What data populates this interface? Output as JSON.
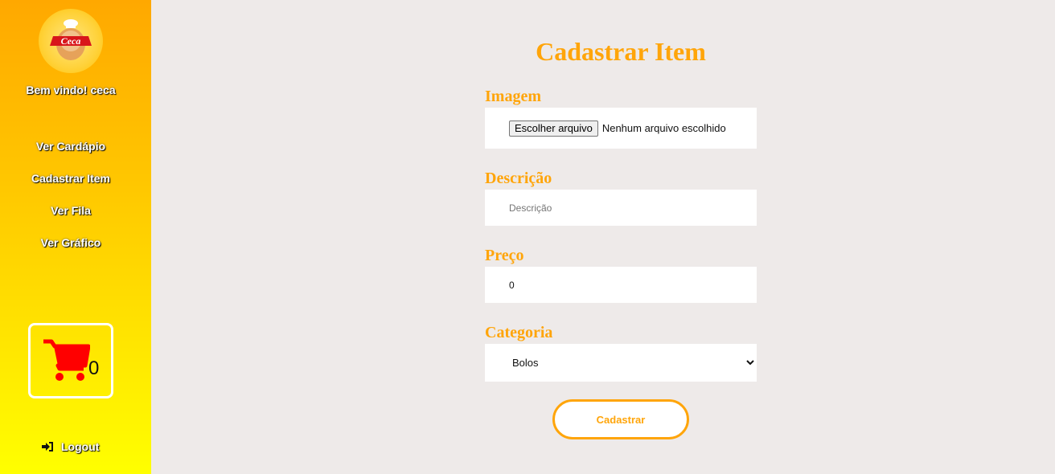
{
  "sidebar": {
    "logo_text": "Ceca",
    "welcome": "Bem vindo! ceca",
    "items": [
      {
        "label": "Ver Cardápio"
      },
      {
        "label": "Cadastrar Item"
      },
      {
        "label": "Ver Fila"
      },
      {
        "label": "Ver Gráfico"
      }
    ],
    "cart": {
      "icon": "shopping-cart-icon",
      "count": "0"
    },
    "logout": {
      "icon": "sign-in-icon",
      "label": "Logout"
    }
  },
  "form": {
    "title": "Cadastrar Item",
    "image": {
      "label": "Imagem",
      "button": "Escolher arquivo",
      "status": "Nenhum arquivo escolhido"
    },
    "description": {
      "label": "Descrição",
      "placeholder": "Descrição",
      "value": ""
    },
    "price": {
      "label": "Preço",
      "value": "0"
    },
    "category": {
      "label": "Categoria",
      "selected": "Bolos"
    },
    "submit": "Cadastrar"
  },
  "colors": {
    "accent": "#ffa50a",
    "background": "#eeeae9",
    "cart": "#ff0000"
  }
}
